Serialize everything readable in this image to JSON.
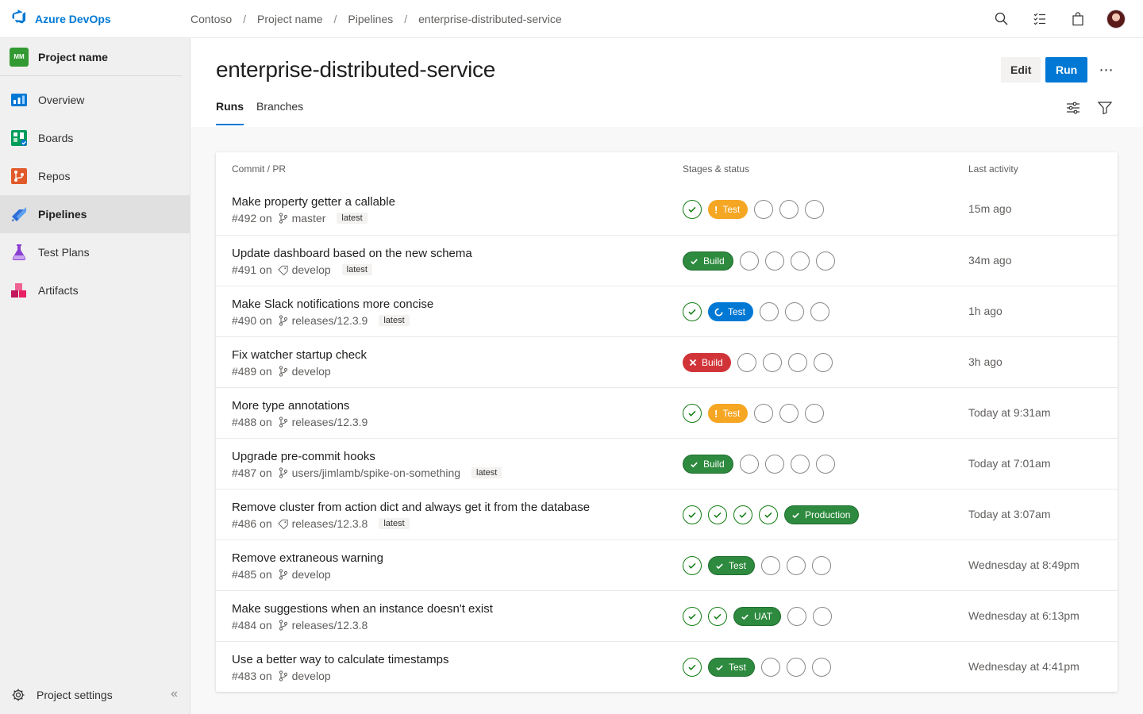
{
  "topbar": {
    "brand": "Azure DevOps",
    "breadcrumbs": [
      "Contoso",
      "Project name",
      "Pipelines",
      "enterprise-distributed-service"
    ],
    "separator": "/"
  },
  "sidebar": {
    "project_badge": "MM",
    "project_name": "Project name",
    "items": [
      {
        "label": "Overview",
        "icon": "overview-icon"
      },
      {
        "label": "Boards",
        "icon": "boards-icon"
      },
      {
        "label": "Repos",
        "icon": "repos-icon"
      },
      {
        "label": "Pipelines",
        "icon": "pipelines-icon",
        "active": true
      },
      {
        "label": "Test Plans",
        "icon": "test-plans-icon"
      },
      {
        "label": "Artifacts",
        "icon": "artifacts-icon"
      }
    ],
    "settings_label": "Project settings",
    "collapse_glyph": "«"
  },
  "header": {
    "title": "enterprise-distributed-service",
    "edit_label": "Edit",
    "run_label": "Run",
    "more_glyph": "⋯",
    "tabs": [
      {
        "label": "Runs",
        "active": true
      },
      {
        "label": "Branches"
      }
    ]
  },
  "table": {
    "headers": {
      "commit": "Commit / PR",
      "stages": "Stages & status",
      "activity": "Last activity"
    },
    "rows": [
      {
        "title": "Make property getter a callable",
        "run": "#492 on",
        "ref_icon": "branch",
        "ref": "master",
        "latest": "latest",
        "stages": [
          "done",
          {
            "status": "warning",
            "label": "Test"
          },
          "pending",
          "pending",
          "pending"
        ],
        "time": "15m ago"
      },
      {
        "title": "Update dashboard based on the new schema",
        "run": "#491 on",
        "ref_icon": "tag",
        "ref": "develop",
        "latest": "latest",
        "stages": [
          {
            "status": "success",
            "label": "Build"
          },
          "pending",
          "pending",
          "pending",
          "pending"
        ],
        "time": "34m ago"
      },
      {
        "title": "Make Slack notifications more concise",
        "run": "#490 on",
        "ref_icon": "branch",
        "ref": "releases/12.3.9",
        "latest": "latest",
        "stages": [
          "done",
          {
            "status": "running",
            "label": "Test"
          },
          "pending",
          "pending",
          "pending"
        ],
        "time": "1h ago"
      },
      {
        "title": "Fix watcher startup check",
        "run": "#489 on",
        "ref_icon": "branch",
        "ref": "develop",
        "latest": "",
        "stages": [
          {
            "status": "failed",
            "label": "Build"
          },
          "pending",
          "pending",
          "pending",
          "pending"
        ],
        "time": "3h ago"
      },
      {
        "title": "More type annotations",
        "run": "#488 on",
        "ref_icon": "branch",
        "ref": "releases/12.3.9",
        "latest": "",
        "stages": [
          "done",
          {
            "status": "warning",
            "label": "Test"
          },
          "pending",
          "pending",
          "pending"
        ],
        "time": "Today at 9:31am"
      },
      {
        "title": "Upgrade pre-commit hooks",
        "run": "#487 on",
        "ref_icon": "branch",
        "ref": "users/jimlamb/spike-on-something",
        "latest": "latest",
        "stages": [
          {
            "status": "success",
            "label": "Build"
          },
          "pending",
          "pending",
          "pending",
          "pending"
        ],
        "time": "Today at 7:01am"
      },
      {
        "title": "Remove cluster from action dict and always get it from the database",
        "run": "#486 on",
        "ref_icon": "tag",
        "ref": "releases/12.3.8",
        "latest": "latest",
        "stages": [
          "done",
          "done",
          "done",
          "done",
          {
            "status": "success",
            "label": "Production"
          }
        ],
        "time": "Today at 3:07am"
      },
      {
        "title": "Remove extraneous warning",
        "run": "#485 on",
        "ref_icon": "branch",
        "ref": "develop",
        "latest": "",
        "stages": [
          "done",
          {
            "status": "success",
            "label": "Test"
          },
          "pending",
          "pending",
          "pending"
        ],
        "time": "Wednesday at 8:49pm"
      },
      {
        "title": "Make suggestions when an instance doesn't exist",
        "run": "#484 on",
        "ref_icon": "branch",
        "ref": "releases/12.3.8",
        "latest": "",
        "stages": [
          "done",
          "done",
          {
            "status": "success",
            "label": "UAT"
          },
          "pending",
          "pending"
        ],
        "time": "Wednesday at 6:13pm"
      },
      {
        "title": "Use a better way to calculate timestamps",
        "run": "#483 on",
        "ref_icon": "branch",
        "ref": "develop",
        "latest": "",
        "stages": [
          "done",
          {
            "status": "success",
            "label": "Test"
          },
          "pending",
          "pending",
          "pending"
        ],
        "time": "Wednesday at 4:41pm"
      }
    ]
  },
  "colors": {
    "accent": "#0078d4",
    "success": "#2d8a3e",
    "warning": "#f5a623",
    "failed": "#d13438",
    "running": "#0078d4"
  }
}
